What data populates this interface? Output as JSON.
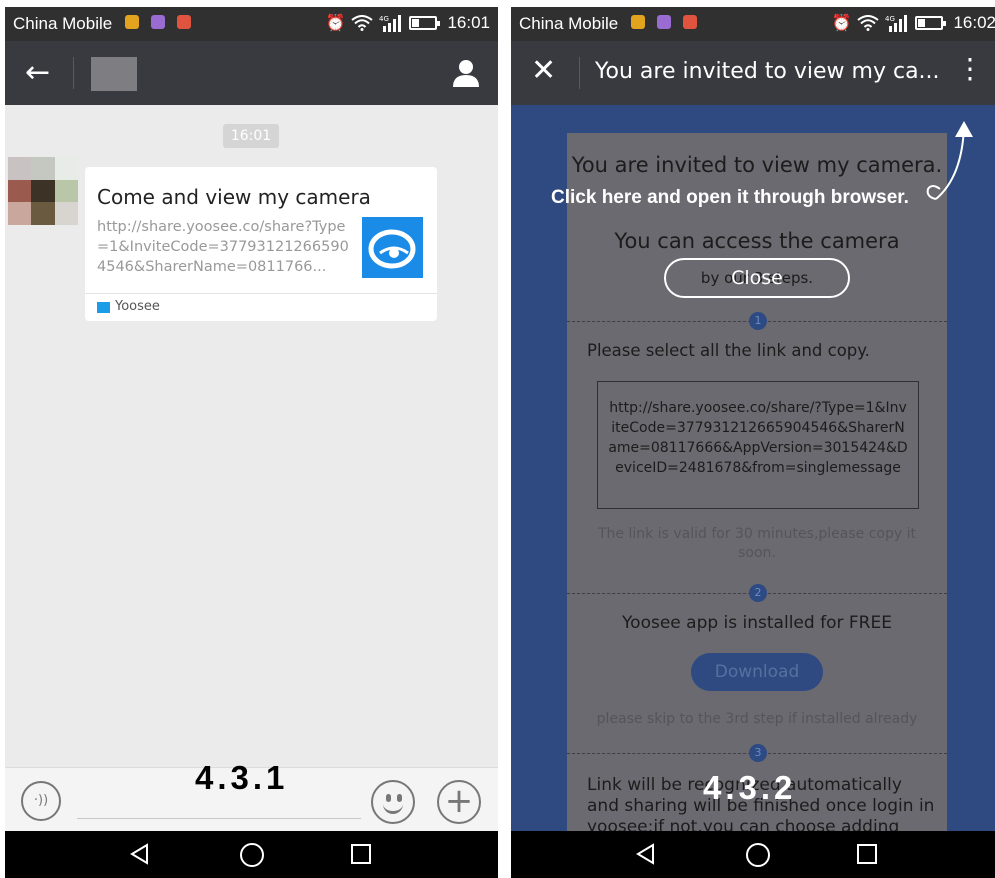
{
  "left_screen": {
    "status": {
      "carrier": "China Mobile",
      "time": "16:01",
      "network": "4G"
    },
    "timestamp": "16:01",
    "message": {
      "title": "Come and view my camera",
      "url": "http://share.yoosee.co/share?Type=1&InviteCode=377931212665904546&SharerName=0811766...",
      "source": "Yoosee"
    },
    "step_label": "4.3.1"
  },
  "right_screen": {
    "status": {
      "carrier": "China Mobile",
      "time": "16:02",
      "network": "4G"
    },
    "page_title": "You are invited to view my ca...",
    "overlay": {
      "instruction": "Click here and open it through browser.",
      "close_label": "Close"
    },
    "web": {
      "heading": "You are invited to view my camera.",
      "subheading": "You can access the camera",
      "subheading2": "by our 3 steps.",
      "step1_number": "1",
      "step1_text": "Please select all the link and copy.",
      "link": "http://share.yoosee.co/share/?Type=1&InviteCode=377931212665904546&SharerName=08117666&AppVersion=3015424&DeviceID=2481678&from=singlemessage",
      "valid_note": "The link is valid for 30 minutes,please copy it soon.",
      "step2_number": "2",
      "step2_text": "Yoosee app is installed for FREE",
      "download_label": "Download",
      "skip_note": "please skip to the 3rd step if installed already",
      "step3_number": "3",
      "step3_text": "Link will be recognized automatically and sharing will be finished once login in yoosee;if not,you can choose adding"
    },
    "step_label": "4.3.2"
  },
  "colors": {
    "status_bar": "#303030",
    "app_bar": "#393a3f",
    "chat_bg": "#ebebeb",
    "overlay_bg": "#2e4a80",
    "yoosee_blue": "#1a8ce8"
  },
  "icons": [
    "back-arrow-icon",
    "person-icon",
    "close-icon",
    "more-vert-icon",
    "voice-icon",
    "emoji-icon",
    "plus-icon",
    "wifi-icon",
    "alarm-icon",
    "battery-icon",
    "nav-back-icon",
    "nav-home-icon",
    "nav-recents-icon"
  ]
}
